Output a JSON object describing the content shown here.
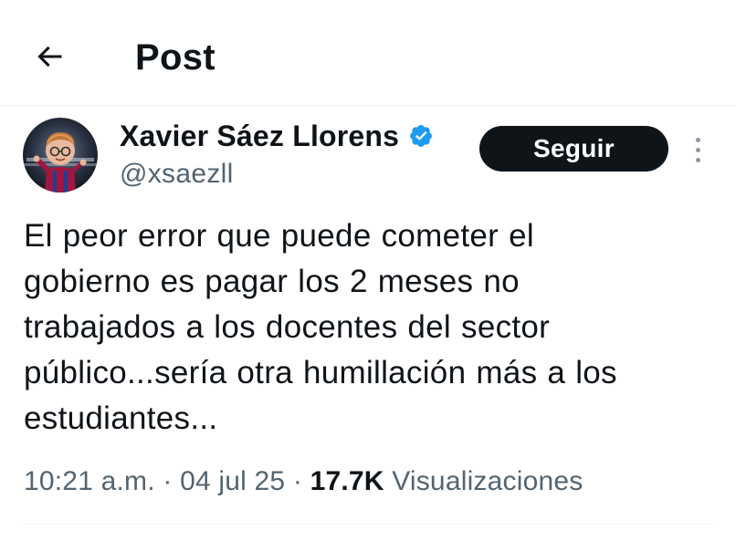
{
  "header": {
    "title": "Post",
    "back_icon": "arrow-left-icon"
  },
  "author": {
    "name": "Xavier Sáez Llorens",
    "handle": "@xsaezll",
    "verified_icon": "verified-badge-icon",
    "verified_color": "#1d9bf0"
  },
  "actions": {
    "follow_label": "Seguir",
    "more_icon": "more-vertical-icon"
  },
  "post": {
    "lines": [
      "El peor error que puede cometer el",
      "gobierno es pagar los 2 meses no",
      "trabajados a los docentes del sector",
      "público...sería otra humillación más a los",
      "estudiantes..."
    ]
  },
  "meta": {
    "time": "10:21 a.m.",
    "separator": "·",
    "date": "04 jul 25",
    "views_count": "17.7K",
    "views_label": "Visualizaciones"
  },
  "colors": {
    "text": "#0f1419",
    "secondary": "#536471",
    "button_bg": "#0f1419",
    "divider": "#eff3f4"
  }
}
